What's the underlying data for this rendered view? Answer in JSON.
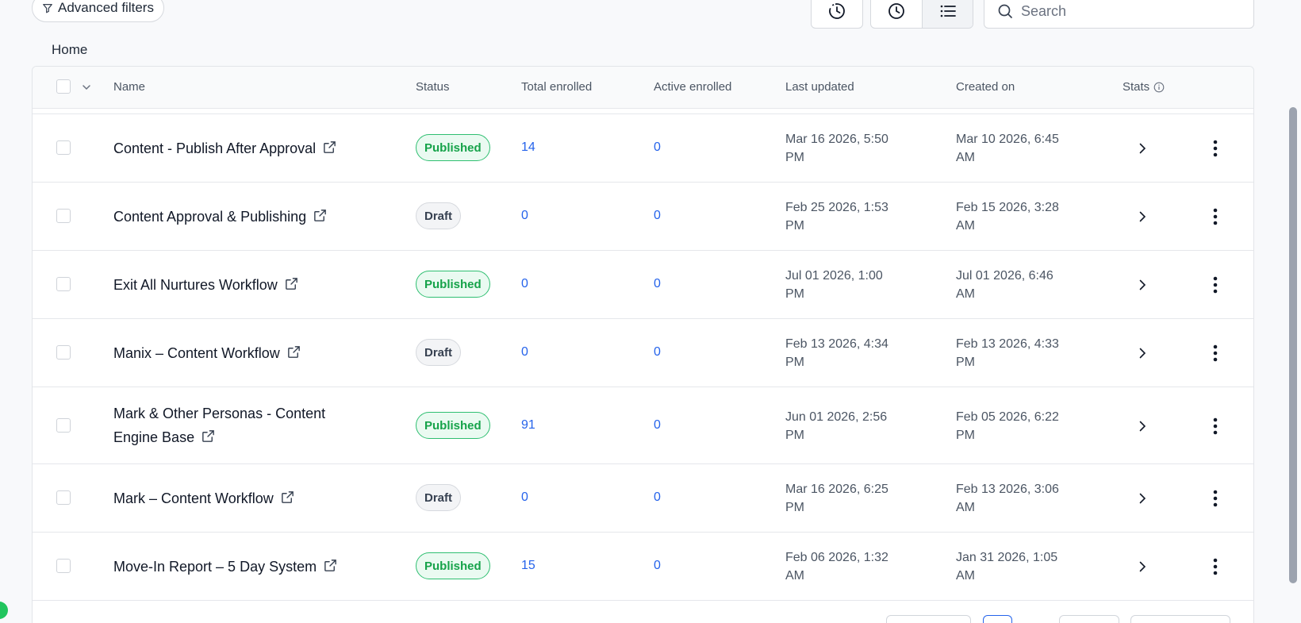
{
  "toolbar": {
    "advanced_filters_label": "Advanced filters",
    "search_placeholder": "Search"
  },
  "breadcrumb": {
    "home": "Home"
  },
  "table": {
    "columns": {
      "name": "Name",
      "status": "Status",
      "total_enrolled": "Total enrolled",
      "active_enrolled": "Active enrolled",
      "last_updated": "Last updated",
      "created_on": "Created on",
      "stats": "Stats"
    },
    "rows": [
      {
        "name": "Content - Publish After Approval",
        "status": "Published",
        "total": "14",
        "active": "0",
        "updated_1": "Mar 16 2026, 5:50",
        "updated_2": "PM",
        "created_1": "Mar 10 2026, 6:45",
        "created_2": "AM"
      },
      {
        "name": "Content Approval & Publishing",
        "status": "Draft",
        "total": "0",
        "active": "0",
        "updated_1": "Feb 25 2026, 1:53",
        "updated_2": "PM",
        "created_1": "Feb 15 2026, 3:28",
        "created_2": "AM"
      },
      {
        "name": "Exit All Nurtures Workflow",
        "status": "Published",
        "total": "0",
        "active": "0",
        "updated_1": "Jul 01 2026, 1:00",
        "updated_2": "PM",
        "created_1": "Jul 01 2026, 6:46",
        "created_2": "AM"
      },
      {
        "name": "Manix – Content Workflow",
        "status": "Draft",
        "total": "0",
        "active": "0",
        "updated_1": "Feb 13 2026, 4:34",
        "updated_2": "PM",
        "created_1": "Feb 13 2026, 4:33",
        "created_2": "PM"
      },
      {
        "name_line1": "Mark & Other Personas - Content",
        "name_line2": "Engine Base",
        "status": "Published",
        "total": "91",
        "active": "0",
        "updated_1": "Jun 01 2026, 2:56",
        "updated_2": "PM",
        "created_1": "Feb 05 2026, 6:22",
        "created_2": "PM"
      },
      {
        "name": "Mark – Content Workflow",
        "status": "Draft",
        "total": "0",
        "active": "0",
        "updated_1": "Mar 16 2026, 6:25",
        "updated_2": "PM",
        "created_1": "Feb 13 2026, 3:06",
        "created_2": "AM"
      },
      {
        "name": "Move-In Report – 5 Day System",
        "status": "Published",
        "total": "15",
        "active": "0",
        "updated_1": "Feb 06 2026, 1:32",
        "updated_2": "AM",
        "created_1": "Jan 31 2026, 1:05",
        "created_2": "AM"
      }
    ]
  },
  "colors": {
    "published_text": "#16a34a",
    "published_border": "#2fbf71",
    "link_blue": "#2563eb"
  },
  "icons": {
    "filter": "funnel-icon",
    "history": "history-icon",
    "clock": "clock-icon",
    "list": "list-icon",
    "search": "search-icon",
    "external": "external-link-icon",
    "stats": "chevron-right-icon",
    "menu": "kebab-menu-icon"
  }
}
